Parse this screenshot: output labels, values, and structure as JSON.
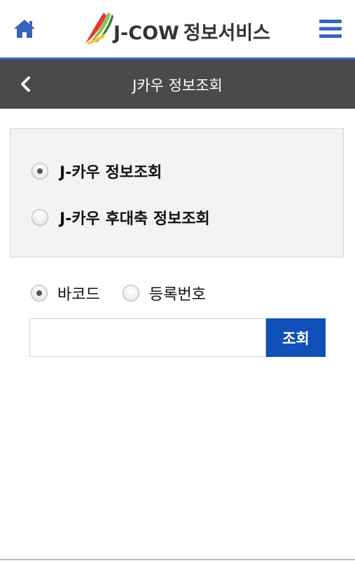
{
  "header": {
    "home_icon": "home-icon",
    "menu_icon": "hamburger-menu-icon",
    "logo_brand": "J-COW",
    "logo_service": "정보서비스",
    "accent_color": "#3b62c2"
  },
  "subheader": {
    "back_icon": "chevron-left-icon",
    "title": "J카우 정보조회",
    "background": "#4a4a4a"
  },
  "query_type": {
    "options": [
      {
        "label": "J-카우 정보조회",
        "checked": true
      },
      {
        "label": "J-카우 후대축 정보조회",
        "checked": false
      }
    ]
  },
  "search_type": {
    "options": [
      {
        "label": "바코드",
        "checked": true
      },
      {
        "label": "등록번호",
        "checked": false
      }
    ]
  },
  "search": {
    "value": "",
    "placeholder": "",
    "button_label": "조회",
    "button_color": "#1050b8"
  }
}
